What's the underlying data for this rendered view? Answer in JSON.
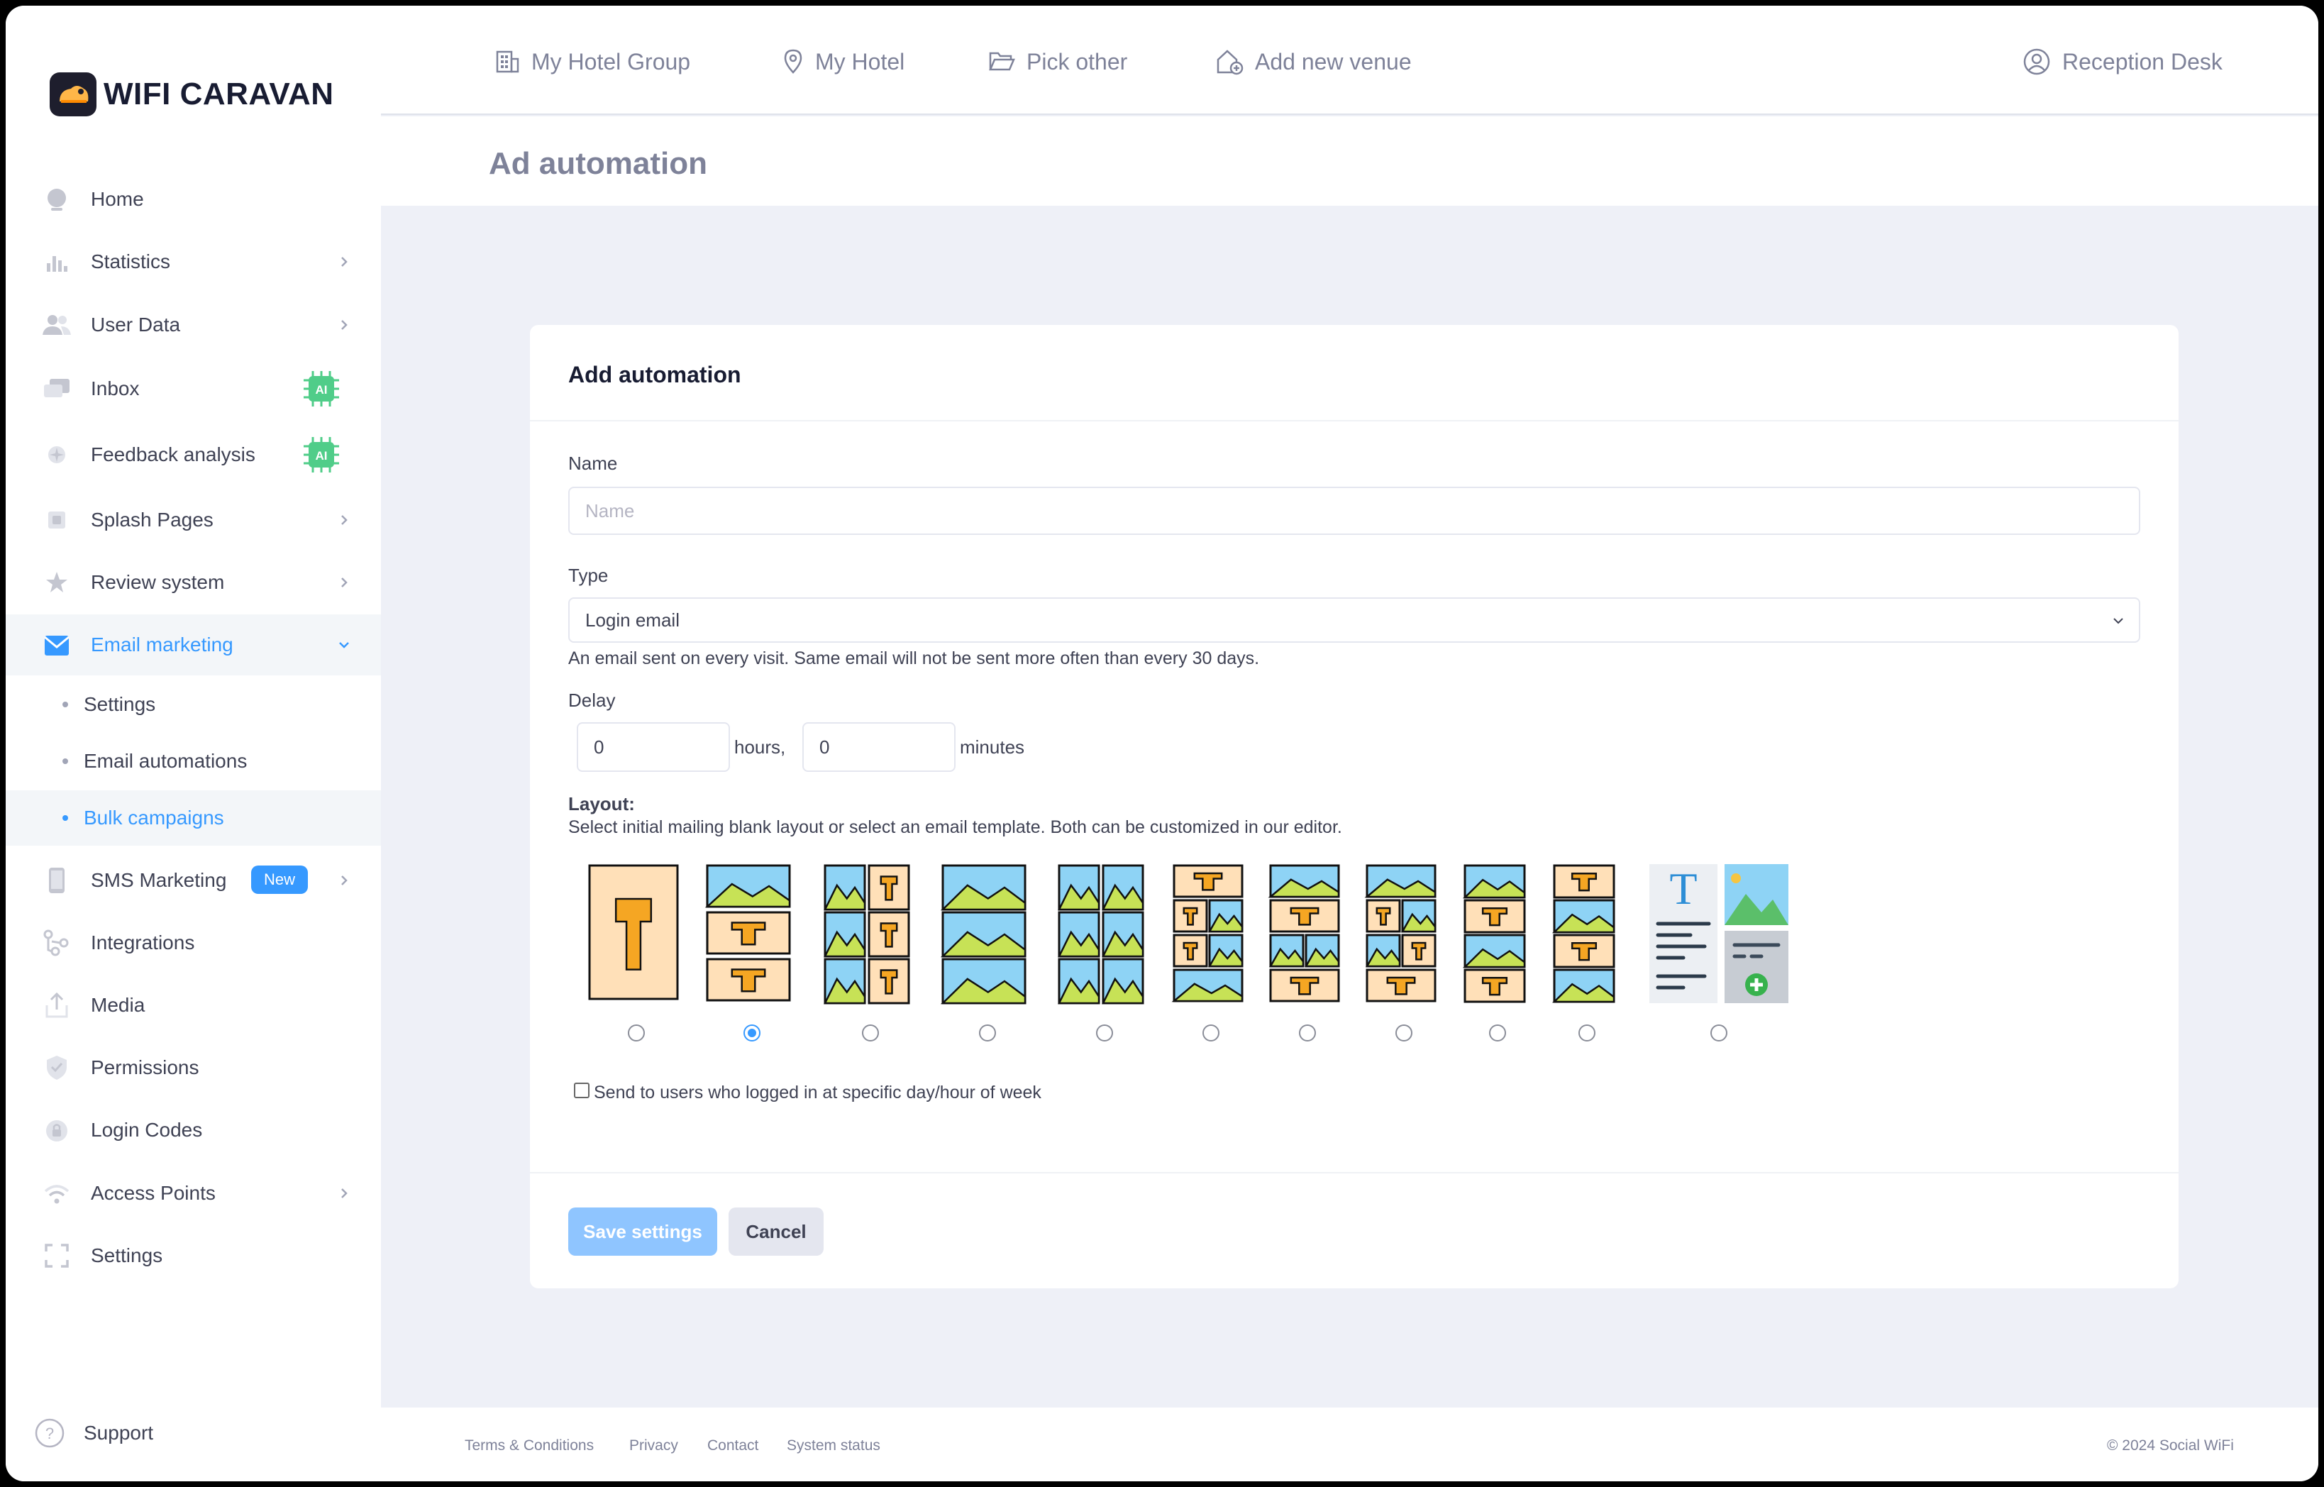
{
  "app": {
    "brand": "WIFI CARAVAN"
  },
  "sidebar": {
    "items": [
      {
        "label": "Home",
        "icon": "globe-icon"
      },
      {
        "label": "Statistics",
        "icon": "bar-chart-icon"
      },
      {
        "label": "User Data",
        "icon": "users-icon"
      },
      {
        "label": "Inbox",
        "icon": "chat-icon",
        "badge": "AI"
      },
      {
        "label": "Feedback analysis",
        "icon": "sparkle-icon",
        "badge": "AI"
      },
      {
        "label": "Splash Pages",
        "icon": "layers-icon"
      },
      {
        "label": "Review system",
        "icon": "star-icon"
      },
      {
        "label": "Email marketing",
        "icon": "envelope-icon"
      },
      {
        "label": "SMS Marketing",
        "icon": "phone-icon",
        "badge": "New"
      },
      {
        "label": "Integrations",
        "icon": "nodes-icon"
      },
      {
        "label": "Media",
        "icon": "upload-icon"
      },
      {
        "label": "Permissions",
        "icon": "shield-icon"
      },
      {
        "label": "Login Codes",
        "icon": "lock-icon"
      },
      {
        "label": "Access Points",
        "icon": "wifi-icon"
      },
      {
        "label": "Settings",
        "icon": "expand-icon"
      }
    ],
    "email_sub": [
      {
        "label": "Settings"
      },
      {
        "label": "Email automations"
      },
      {
        "label": "Bulk campaigns"
      }
    ],
    "support": "Support"
  },
  "topbar": {
    "hotel_group": "My Hotel Group",
    "hotel": "My Hotel",
    "pick_other": "Pick other",
    "add_venue": "Add new venue",
    "user": "Reception Desk"
  },
  "page": {
    "title": "Ad automation"
  },
  "form": {
    "card_title": "Add automation",
    "name_label": "Name",
    "name_placeholder": "Name",
    "name_value": "",
    "type_label": "Type",
    "type_value": "Login email",
    "type_hint": "An email sent on every visit. Same email will not be sent more often than every 30 days.",
    "delay_label": "Delay",
    "delay_hours": "0",
    "hours_unit": "hours,",
    "delay_minutes": "0",
    "minutes_unit": "minutes",
    "layout_label": "Layout:",
    "layout_hint": "Select initial mailing blank layout or select an email template. Both can be customized in our editor.",
    "layout_selected_index": 1,
    "specific_day_label": "Send to users who logged in at specific day/hour of week",
    "save_label": "Save settings",
    "cancel_label": "Cancel"
  },
  "footer": {
    "terms": "Terms & Conditions",
    "privacy": "Privacy",
    "contact": "Contact",
    "status": "System status",
    "copyright": "© 2024 Social WiFi"
  },
  "colors": {
    "accent": "#3699ff",
    "ai_badge": "#50cd89",
    "tile_bg": "#ffe0b8",
    "image_sky": "#8ed3f5",
    "image_hill": "#c7e256"
  }
}
